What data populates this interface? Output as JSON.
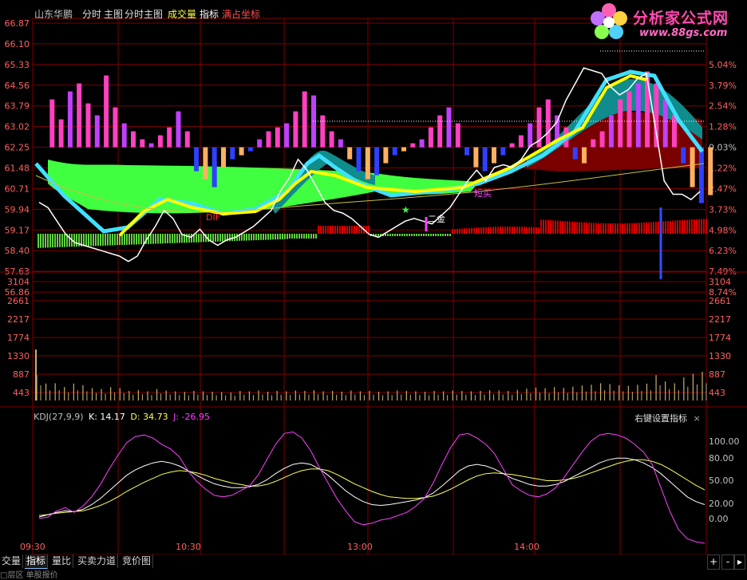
{
  "header": {
    "stock_name": "山东华鹏",
    "menu_fenshi": "分时",
    "menu_zhutu": "主图",
    "menu_fenshi_zhutu": "分时主图",
    "menu_volume": "成交量",
    "menu_indicator": "指标",
    "menu_fullcoord": "满占坐标"
  },
  "logo": {
    "title": "分析家公式网",
    "url_text": "www.88gs.com"
  },
  "price_axis": {
    "left": [
      "66.87",
      "66.10",
      "65.33",
      "64.56",
      "63.79",
      "63.02",
      "62.25",
      "61.48",
      "60.71",
      "59.94",
      "59.17",
      "58.40",
      "57.63",
      "56.86"
    ],
    "right": [
      "",
      "",
      "5.04%",
      "3.79%",
      "2.54%",
      "1.28%",
      "0.03%",
      "1.22%",
      "2.47%",
      "3.73%",
      "4.98%",
      "6.23%",
      "7.49%",
      "8.74%"
    ]
  },
  "volume_axis": {
    "labels": [
      "3104",
      "2661",
      "2217",
      "1774",
      "1330",
      "887",
      "443"
    ]
  },
  "kdj": {
    "title": "KDJ(27,9,9)",
    "k_label": "K: 14.17",
    "d_label": "D: 34.73",
    "j_label": "J: -26.95",
    "setting_label": "右键设置指标",
    "close_label": "×",
    "axis": [
      "100.00",
      "80.00",
      "50.00",
      "20.00",
      "0.00"
    ],
    "k": [
      2,
      5,
      8,
      10,
      9,
      12,
      18,
      26,
      36,
      46,
      56,
      63,
      68,
      72,
      74,
      72,
      68,
      62,
      56,
      50,
      45,
      42,
      40,
      40,
      41,
      44,
      50,
      58,
      65,
      70,
      72,
      70,
      64,
      56,
      46,
      36,
      28,
      22,
      18,
      17,
      18,
      20,
      22,
      24,
      27,
      33,
      42,
      52,
      62,
      68,
      70,
      68,
      64,
      58,
      52,
      48,
      44,
      42,
      42,
      44,
      48,
      54,
      60,
      66,
      72,
      76,
      78,
      78,
      76,
      72,
      66,
      58,
      48,
      38,
      28,
      22,
      18
    ],
    "d": [
      4,
      5,
      7,
      8,
      9,
      10,
      13,
      17,
      22,
      28,
      35,
      41,
      47,
      52,
      57,
      60,
      62,
      61,
      59,
      56,
      52,
      49,
      46,
      44,
      42,
      42,
      44,
      48,
      53,
      58,
      62,
      64,
      64,
      62,
      57,
      51,
      45,
      40,
      35,
      31,
      28,
      27,
      26,
      26,
      27,
      29,
      33,
      38,
      44,
      50,
      55,
      58,
      59,
      58,
      57,
      55,
      53,
      51,
      49,
      49,
      50,
      52,
      55,
      59,
      63,
      67,
      71,
      74,
      76,
      76,
      74,
      70,
      64,
      57,
      50,
      43,
      37
    ],
    "j": [
      0,
      2,
      10,
      14,
      8,
      16,
      28,
      44,
      64,
      82,
      98,
      106,
      108,
      104,
      96,
      90,
      80,
      62,
      48,
      38,
      30,
      28,
      30,
      36,
      42,
      56,
      76,
      96,
      110,
      112,
      104,
      88,
      66,
      46,
      26,
      10,
      -4,
      -8,
      -6,
      -2,
      0,
      4,
      8,
      16,
      26,
      46,
      70,
      92,
      108,
      110,
      104,
      96,
      84,
      64,
      44,
      36,
      30,
      28,
      32,
      40,
      54,
      70,
      86,
      100,
      108,
      110,
      108,
      104,
      96,
      86,
      70,
      40,
      10,
      -14,
      -26,
      -30,
      -32
    ]
  },
  "labels_on_chart": {
    "dif": "DIF",
    "buy": "短买",
    "er_jin": "二金",
    "star": "★"
  },
  "time_axis": {
    "labels": [
      "09:30",
      "10:30",
      "13:00",
      "14:00"
    ]
  },
  "bottom_tabs": [
    "交量",
    "指标",
    "量比",
    "买卖力道",
    "竞价图"
  ],
  "active_tab": "指标",
  "bottom_buttons": [
    "+",
    "-"
  ],
  "status_text": "□层区  单股报价",
  "chart_data": {
    "type": "line",
    "price_range": [
      56.86,
      66.87
    ],
    "price_series": [
      60.2,
      60.0,
      59.5,
      59.0,
      58.7,
      58.6,
      58.5,
      58.4,
      58.3,
      58.2,
      58.0,
      58.2,
      58.8,
      59.3,
      59.9,
      59.6,
      59.0,
      58.9,
      59.2,
      58.8,
      58.6,
      58.8,
      58.9,
      59.1,
      59.3,
      59.6,
      59.9,
      60.6,
      61.1,
      61.8,
      61.4,
      60.8,
      60.2,
      59.9,
      59.8,
      59.6,
      59.3,
      59.0,
      58.9,
      59.1,
      59.3,
      59.5,
      59.6,
      59.5,
      59.4,
      59.7,
      60.0,
      60.5,
      61.0,
      61.4,
      61.0,
      61.5,
      61.6,
      61.5,
      61.8,
      62.3,
      62.5,
      62.8,
      63.2,
      64.0,
      64.6,
      65.2,
      65.1,
      65.0,
      64.5,
      64.2,
      64.4,
      64.8,
      65.0,
      63.0,
      61.0,
      60.5,
      60.5,
      60.3,
      60.6
    ],
    "volume_values": [
      1330,
      887,
      900,
      700,
      887,
      800,
      650,
      600,
      700,
      650,
      500,
      550,
      480,
      600,
      520,
      480,
      450,
      500,
      480,
      460,
      440,
      420,
      500,
      480,
      520,
      460,
      500,
      480,
      520,
      500,
      540,
      480,
      500,
      460,
      520,
      480,
      500,
      460,
      480,
      520,
      500,
      480,
      460,
      500,
      480,
      520,
      500,
      480,
      500,
      540,
      520,
      500,
      560,
      620,
      680,
      640,
      700,
      660,
      720,
      780,
      820,
      900,
      860,
      800,
      760,
      820,
      880,
      1330,
      1000,
      900,
      1200,
      1400,
      1500
    ]
  },
  "colors": {
    "grid": "#800000",
    "axis_text_left": "#ff6060",
    "k_line": "#ffffff",
    "d_line": "#ffff60",
    "j_line": "#ff40ff",
    "cyan_band": "#40e0ff",
    "green_band": "#40ff40",
    "yellow_band": "#ffff00"
  }
}
